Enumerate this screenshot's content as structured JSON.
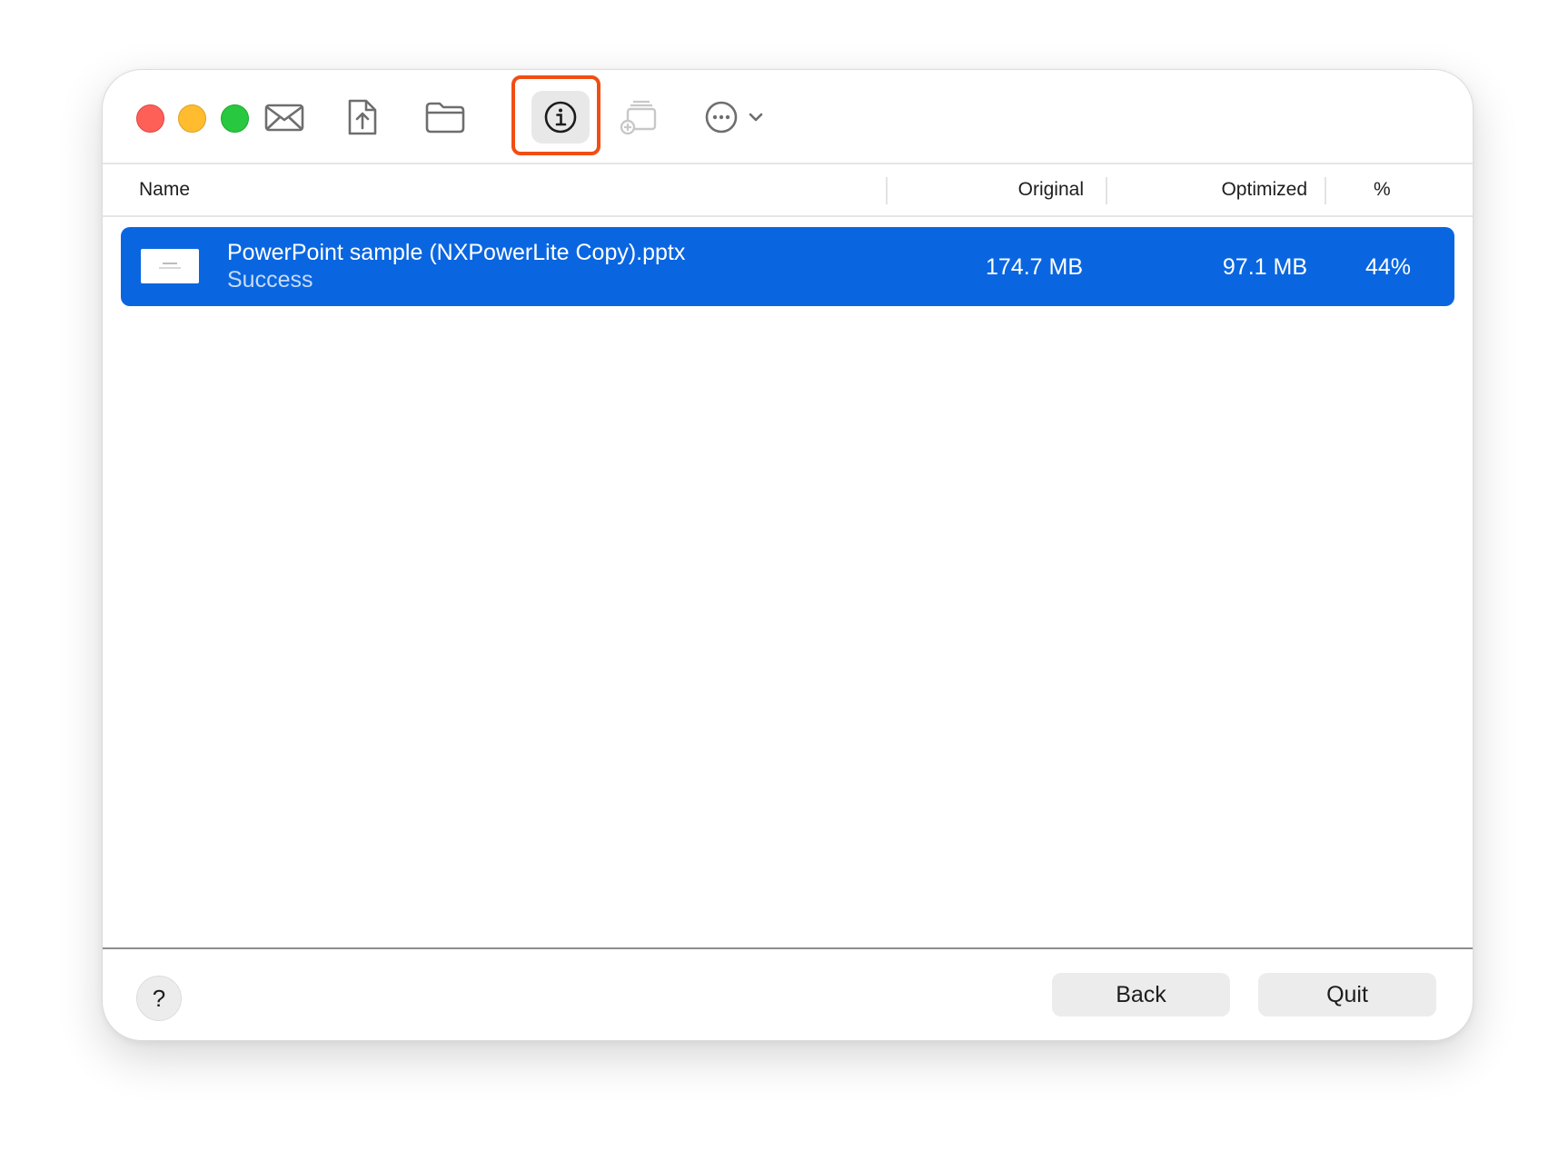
{
  "toolbar": {
    "buttons": [
      {
        "icon": "envelope-icon"
      },
      {
        "icon": "document-share-icon"
      },
      {
        "icon": "folder-icon"
      },
      {
        "icon": "info-circle-icon",
        "state": "selected, highlighted"
      },
      {
        "icon": "add-to-stack-icon",
        "state": "disabled"
      },
      {
        "icon": "more-options-icon",
        "menu": "chevron-down-icon"
      }
    ],
    "highlight_color": "#f04e13"
  },
  "table": {
    "columns": [
      "Name",
      "Original",
      "Optimized",
      "%"
    ],
    "rows": [
      {
        "name": "PowerPoint sample (NXPowerLite Copy).pptx",
        "status": "Success",
        "original": "174.7 MB",
        "optimized": "97.1 MB",
        "percent": "44%",
        "selected": true
      }
    ],
    "selection_color": "#0a66e0"
  },
  "footer": {
    "help_label": "?",
    "back_label": "Back",
    "quit_label": "Quit"
  }
}
